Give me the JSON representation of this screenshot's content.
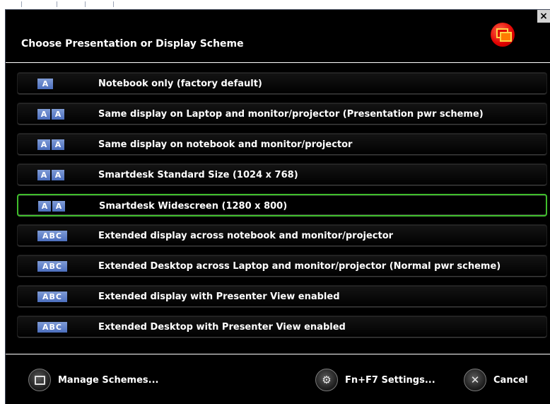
{
  "window": {
    "title": "Choose Presentation or Display Scheme",
    "close_glyph": "×"
  },
  "schemes": [
    {
      "badge": [
        "A"
      ],
      "label": "Notebook only (factory default)",
      "selected": false
    },
    {
      "badge": [
        "A",
        "A"
      ],
      "label": "Same display on Laptop and monitor/projector (Presentation pwr scheme)",
      "selected": false
    },
    {
      "badge": [
        "A",
        "A"
      ],
      "label": "Same display on notebook and monitor/projector",
      "selected": false
    },
    {
      "badge": [
        "A",
        "A"
      ],
      "label": "Smartdesk Standard Size (1024 x 768)",
      "selected": false
    },
    {
      "badge": [
        "A",
        "A"
      ],
      "label": "Smartdesk Widescreen (1280 x 800)",
      "selected": true
    },
    {
      "badge": [
        "ABC"
      ],
      "label": "Extended display across notebook and monitor/projector",
      "selected": false
    },
    {
      "badge": [
        "ABC"
      ],
      "label": "Extended Desktop across Laptop and monitor/projector (Normal pwr scheme)",
      "selected": false
    },
    {
      "badge": [
        "ABC"
      ],
      "label": "Extended display with Presenter View enabled",
      "selected": false
    },
    {
      "badge": [
        "ABC"
      ],
      "label": "Extended Desktop with Presenter View enabled",
      "selected": false
    }
  ],
  "footer": {
    "manage_label": "Manage Schemes...",
    "settings_label": "Fn+F7 Settings...",
    "cancel_label": "Cancel"
  },
  "colors": {
    "background": "#000000",
    "selection_border": "#3fbe2c",
    "badge": "#6a88cc",
    "app_icon": "#e10000"
  },
  "icons": {
    "app": "dual-monitor-icon",
    "manage": "monitor-icon",
    "settings": "gear-icon",
    "cancel": "close-icon"
  }
}
